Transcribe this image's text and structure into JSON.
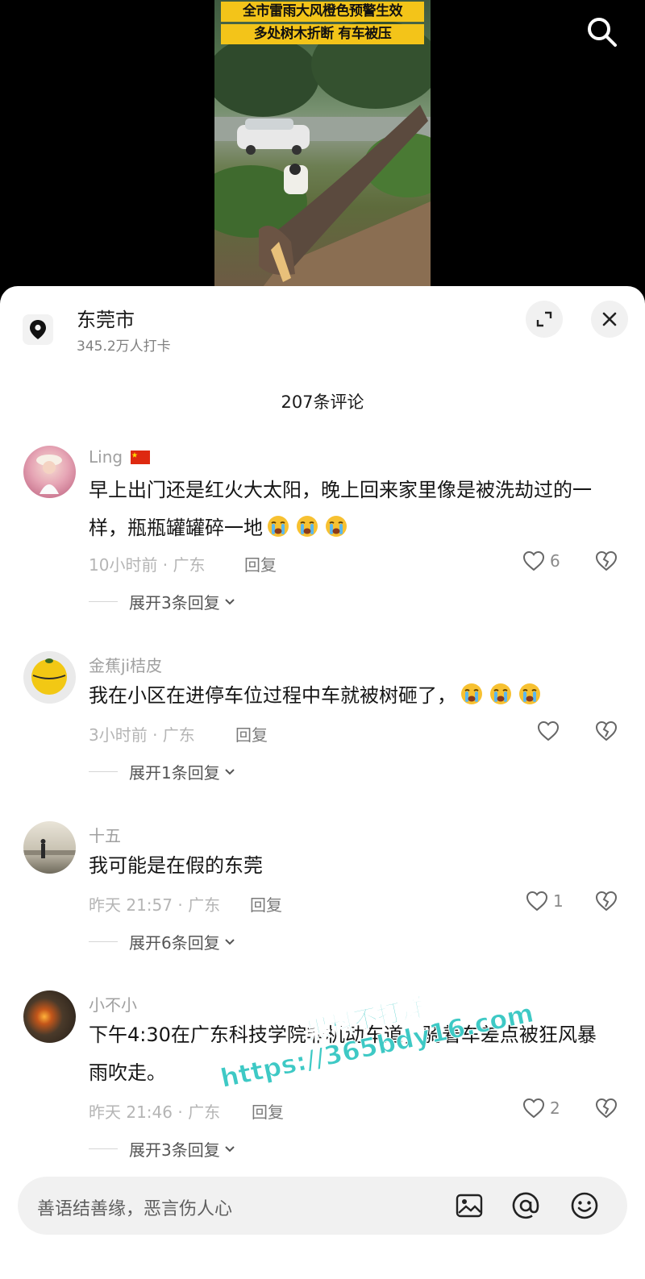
{
  "video": {
    "caption_line1": "全市雷雨大风橙色预警生效",
    "caption_line2": "多处树木折断 有车被压",
    "caption_bg_color": "#f3c419"
  },
  "header": {
    "location_icon": "location-pin-icon",
    "location_name": "东莞市",
    "checkins": "345.2万人打卡",
    "expand_icon": "expand-icon",
    "close_icon": "close-icon",
    "search_icon": "search-icon"
  },
  "comments_title": "207条评论",
  "comments": [
    {
      "user": "Ling",
      "user_flag": "china-flag-icon",
      "text": "早上出门还是红火大太阳，晚上回来家里像是被洗劫过的一样，瓶瓶罐罐碎一地",
      "emoji": [
        "crying-face-icon",
        "crying-face-icon",
        "crying-face-icon"
      ],
      "time": "10小时前 · 广东",
      "reply_label": "回复",
      "likes": "6",
      "expand": "展开3条回复"
    },
    {
      "user": "金蕉ji桔皮",
      "text": "我在小区在进停车位过程中车就被树砸了，",
      "emoji": [
        "crying-face-icon",
        "crying-face-icon",
        "crying-face-icon"
      ],
      "time": "3小时前 · 广东",
      "reply_label": "回复",
      "likes": "",
      "expand": "展开1条回复"
    },
    {
      "user": "十五",
      "text": "我可能是在假的东莞",
      "time": "昨天 21:57 · 广东",
      "reply_label": "回复",
      "likes": "1",
      "expand": "展开6条回复"
    },
    {
      "user": "小不小",
      "text": "下午4:30在广东科技学院非机动车道，骑着车差点被狂风暴雨吹走。",
      "time": "昨天 21:46 · 广东",
      "reply_label": "回复",
      "likes": "2",
      "expand": "展开3条回复"
    }
  ],
  "watermark": {
    "line1": "黑料不打烊",
    "line2": "https://365bdy16.com",
    "color": "#3ec9c5"
  },
  "input": {
    "placeholder": "善语结善缘，恶言伤人心",
    "icons": [
      "image-icon",
      "at-mention-icon",
      "emoji-icon"
    ]
  }
}
